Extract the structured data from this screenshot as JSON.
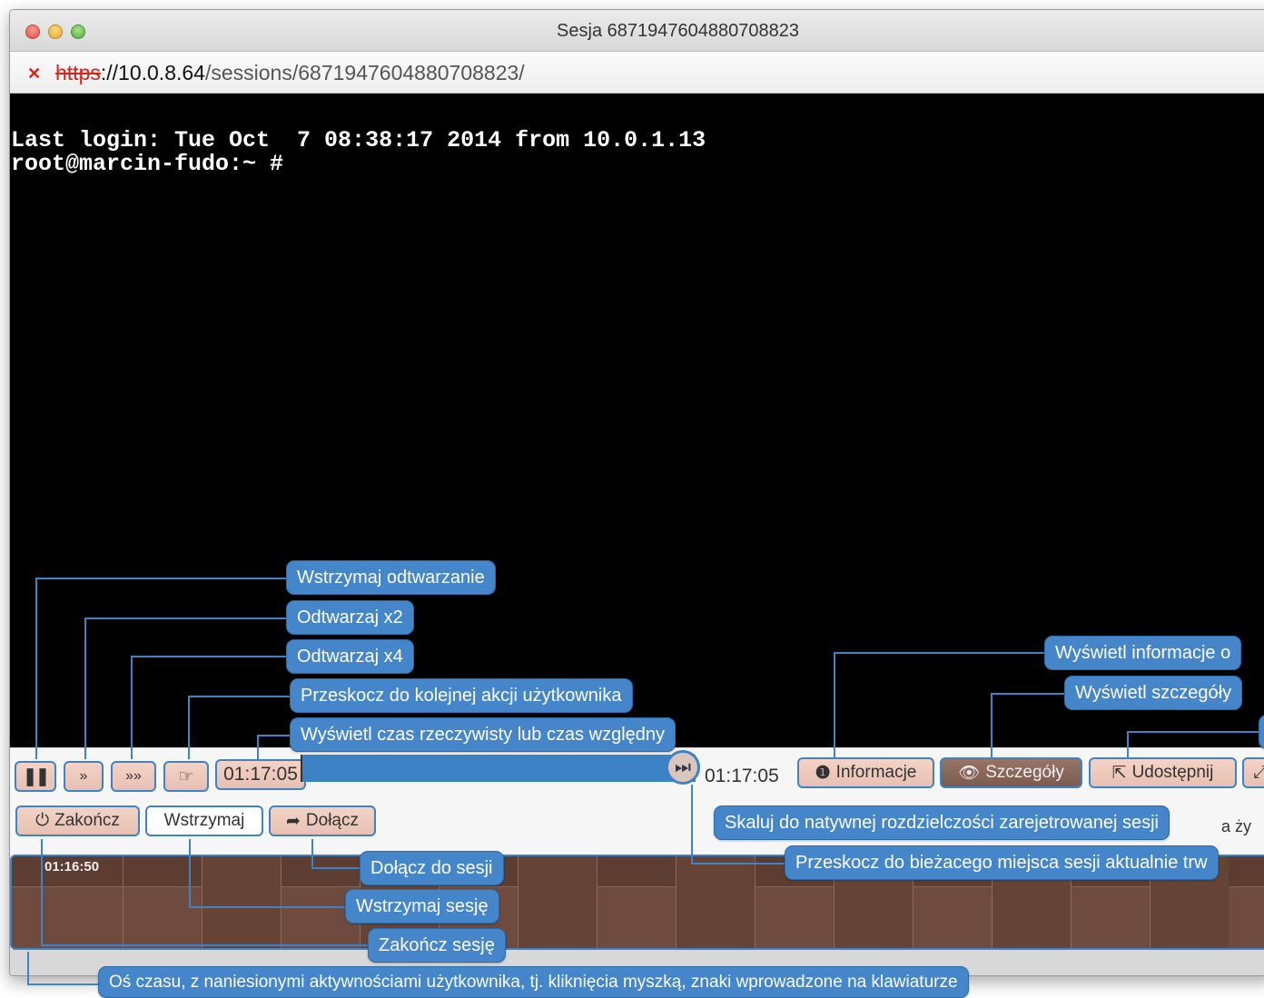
{
  "window": {
    "title": "Sesja 6871947604880708823"
  },
  "url": {
    "protocol": "https",
    "host": "://10.0.8.64",
    "path": "/sessions/6871947604880708823/"
  },
  "terminal": {
    "lines": [
      "Last login: Tue Oct  7 08:38:17 2014 from 10.0.1.13",
      "root@marcin-fudo:~ #"
    ]
  },
  "controls": {
    "pause_icon": "pause-icon",
    "speed2_label": "»",
    "speed4_label": "»»",
    "skip_icon": "hand-pointer-icon",
    "current_time": "01:17:05",
    "end_time": "01:17:05",
    "progress_fraction": 1.0,
    "info_label": "Informacje",
    "details_label": "Szczegóły",
    "share_label": "Udostępnij",
    "terminate_label": "Zakończ",
    "pause_session_label": "Wstrzymaj",
    "join_label": "Dołącz",
    "hidden_fragment": "a ży"
  },
  "timeline": {
    "start_time": "01:16:50"
  },
  "callouts": {
    "pause_playback": "Wstrzymaj odtwarzanie",
    "play_x2": "Odtwarzaj x2",
    "play_x4": "Odtwarzaj x4",
    "skip_next_action": "Przeskocz do kolejnej akcji użytkownika",
    "show_time": "Wyświetl czas rzeczywisty lub czas względny",
    "show_info": "Wyświetl informacje o",
    "show_details": "Wyświetl szczegóły",
    "scale_native": "Skaluj do natywnej rozdzielczości zarejetrowanej sesji",
    "jump_current": "Przeskocz do bieżacego miejsca sesji aktualnie trw",
    "join_session": "Dołącz do sesji",
    "pause_session": "Wstrzymaj sesję",
    "terminate_session": "Zakończ sesję",
    "timeline_axis": "Oś czasu, z naniesionymi aktywnościami użytkownika, tj. kliknięcia myszką, znaki wprowadzone na klawiaturze"
  },
  "colors": {
    "accent": "#4585c9",
    "button_bg": "#f3d3c6",
    "timeline_bg": "#6e4b3e",
    "terminal_bg": "#000000"
  }
}
